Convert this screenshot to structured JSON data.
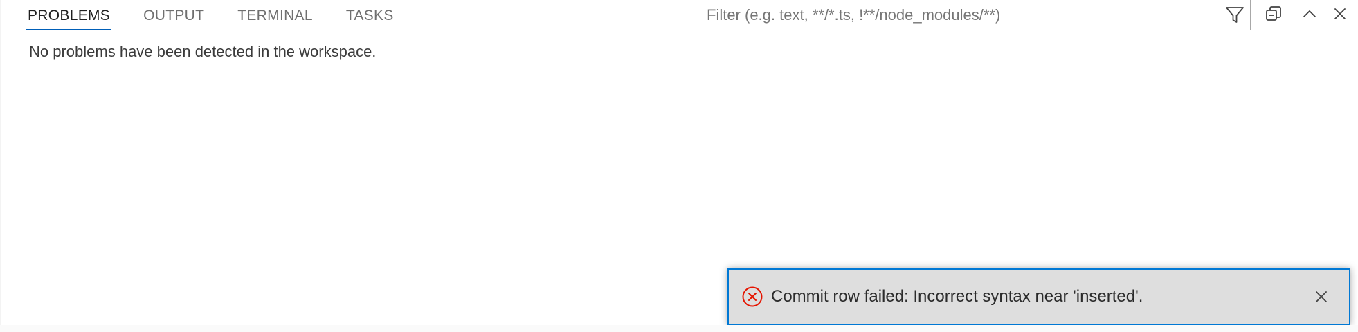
{
  "tabs": [
    {
      "label": "PROBLEMS",
      "active": true
    },
    {
      "label": "OUTPUT",
      "active": false
    },
    {
      "label": "TERMINAL",
      "active": false
    },
    {
      "label": "TASKS",
      "active": false
    }
  ],
  "filter": {
    "placeholder": "Filter (e.g. text, **/*.ts, !**/node_modules/**)",
    "value": "",
    "icon": "filter-icon"
  },
  "actions": [
    {
      "name": "collapse-all-icon"
    },
    {
      "name": "chevron-up-icon"
    },
    {
      "name": "close-icon"
    }
  ],
  "problems": {
    "message": "No problems have been detected in the workspace."
  },
  "notification": {
    "icon": "error-icon",
    "text": "Commit row failed: Incorrect syntax near 'inserted'.",
    "close_icon": "close-icon"
  },
  "colors": {
    "accent": "#005fb8",
    "toast_border": "#0078d4",
    "error": "#e51400",
    "toast_bg": "#dedede"
  }
}
